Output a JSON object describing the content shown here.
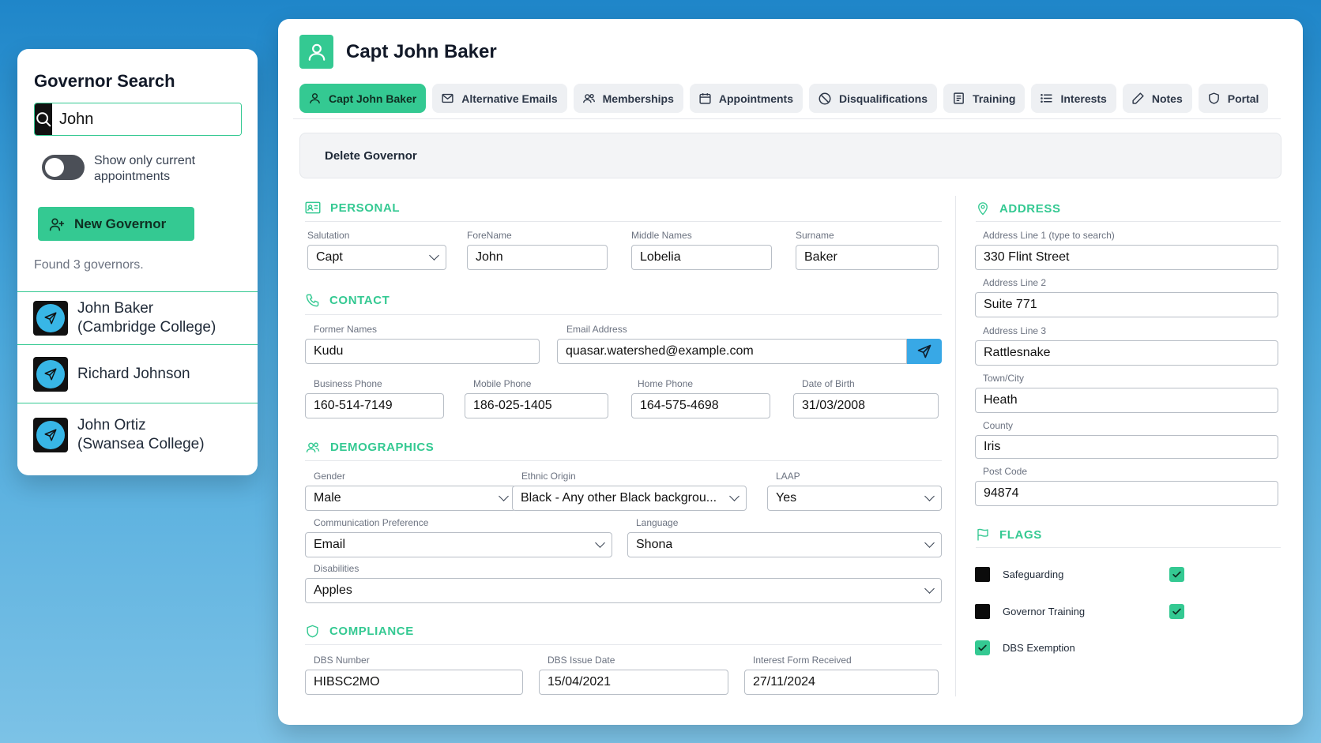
{
  "search": {
    "title": "Governor Search",
    "query": "John",
    "toggle_label": "Show only current appointments",
    "new_button": "New Governor",
    "found_text": "Found 3 governors.",
    "results": [
      {
        "name": "John Baker\n(Cambridge College)"
      },
      {
        "name": "Richard Johnson"
      },
      {
        "name": "John Ortiz\n(Swansea College)"
      }
    ]
  },
  "header": {
    "title": "Capt John Baker"
  },
  "tabs": [
    {
      "label": "Capt John Baker",
      "icon": "user-icon"
    },
    {
      "label": "Alternative Emails",
      "icon": "mail-icon"
    },
    {
      "label": "Memberships",
      "icon": "users-icon"
    },
    {
      "label": "Appointments",
      "icon": "calendar-icon"
    },
    {
      "label": "Disqualifications",
      "icon": "ban-icon"
    },
    {
      "label": "Training",
      "icon": "document-icon"
    },
    {
      "label": "Interests",
      "icon": "list-icon"
    },
    {
      "label": "Notes",
      "icon": "pencil-icon"
    },
    {
      "label": "Portal",
      "icon": "shield-icon"
    }
  ],
  "delete_label": "Delete Governor",
  "personal": {
    "heading": "PERSONAL",
    "salutation": {
      "label": "Salutation",
      "value": "Capt"
    },
    "forename": {
      "label": "ForeName",
      "value": "John"
    },
    "middle": {
      "label": "Middle Names",
      "value": "Lobelia"
    },
    "surname": {
      "label": "Surname",
      "value": "Baker"
    }
  },
  "contact": {
    "heading": "CONTACT",
    "former": {
      "label": "Former Names",
      "value": "Kudu"
    },
    "email": {
      "label": "Email Address",
      "value": "quasar.watershed@example.com"
    },
    "business": {
      "label": "Business Phone",
      "value": "160-514-7149"
    },
    "mobile": {
      "label": "Mobile Phone",
      "value": "186-025-1405"
    },
    "home": {
      "label": "Home Phone",
      "value": "164-575-4698"
    },
    "dob": {
      "label": "Date of Birth",
      "value": "31/03/2008"
    }
  },
  "demographics": {
    "heading": "DEMOGRAPHICS",
    "gender": {
      "label": "Gender",
      "value": "Male"
    },
    "ethnic": {
      "label": "Ethnic Origin",
      "value": "Black - Any other Black backgrou..."
    },
    "laap": {
      "label": "LAAP",
      "value": "Yes"
    },
    "comm": {
      "label": "Communication Preference",
      "value": "Email"
    },
    "language": {
      "label": "Language",
      "value": "Shona"
    },
    "disabilities": {
      "label": "Disabilities",
      "value": "Apples"
    }
  },
  "compliance": {
    "heading": "COMPLIANCE",
    "dbs_number": {
      "label": "DBS Number",
      "value": "HIBSC2MO"
    },
    "dbs_date": {
      "label": "DBS Issue Date",
      "value": "15/04/2021"
    },
    "interest_form": {
      "label": "Interest Form Received",
      "value": "27/11/2024"
    }
  },
  "address": {
    "heading": "ADDRESS",
    "line1": {
      "label": "Address Line 1 (type to search)",
      "value": "330 Flint Street"
    },
    "line2": {
      "label": "Address Line 2",
      "value": "Suite 771"
    },
    "line3": {
      "label": "Address Line 3",
      "value": "Rattlesnake"
    },
    "town": {
      "label": "Town/City",
      "value": "Heath"
    },
    "county": {
      "label": "County",
      "value": "Iris"
    },
    "postcode": {
      "label": "Post Code",
      "value": "94874"
    }
  },
  "flags": {
    "heading": "FLAGS",
    "items": [
      {
        "label": "Safeguarding",
        "checked": true
      },
      {
        "label": "Governor Training",
        "checked": true
      },
      {
        "label": "DBS Exemption",
        "checked": true
      }
    ]
  },
  "colors": {
    "accent": "#34c992",
    "send": "#38a8e6"
  }
}
